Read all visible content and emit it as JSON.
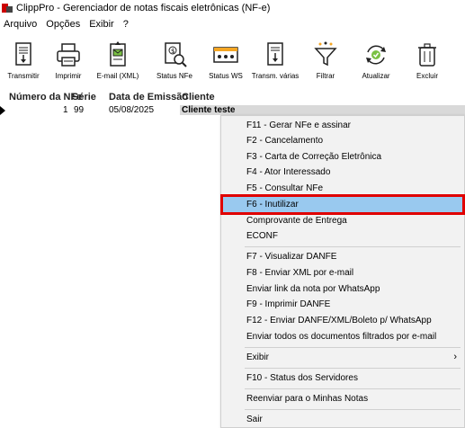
{
  "window": {
    "title": "ClippPro - Gerenciador de notas fiscais eletrônicas (NF-e)"
  },
  "menubar": [
    "Arquivo",
    "Opções",
    "Exibir",
    "?"
  ],
  "toolbar": [
    {
      "label": "Transmitir",
      "icon": "transmit-icon"
    },
    {
      "label": "Imprimir",
      "icon": "printer-icon"
    },
    {
      "label": "E-mail (XML)",
      "icon": "email-xml-icon"
    },
    {
      "label": "Status NFe",
      "icon": "status-nfe-icon"
    },
    {
      "label": "Status WS",
      "icon": "status-ws-icon"
    },
    {
      "label": "Transm. várias",
      "icon": "transmit-multiple-icon"
    },
    {
      "label": "Filtrar",
      "icon": "filter-icon"
    },
    {
      "label": "Atualizar",
      "icon": "refresh-icon"
    },
    {
      "label": "Excluir",
      "icon": "trash-icon"
    }
  ],
  "list": {
    "columns": [
      "Número da NFe",
      "Série",
      "Data de Emissão",
      "Cliente"
    ],
    "rows": [
      {
        "numero": "1",
        "serie": "99",
        "data": "05/08/2025",
        "cliente": "Cliente teste"
      }
    ]
  },
  "context_menu": {
    "items": [
      "F11 - Gerar NFe e assinar",
      "F2 - Cancelamento",
      "F3 - Carta de Correção Eletrônica",
      "F4 - Ator Interessado",
      "F5 - Consultar NFe",
      "F6 - Inutilizar",
      "Comprovante de Entrega",
      "ECONF",
      "F7 - Visualizar DANFE",
      "F8 - Enviar XML por e-mail",
      "Enviar link da nota por WhatsApp",
      "F9 - Imprimir DANFE",
      "F12 - Enviar DANFE/XML/Boleto p/ WhatsApp",
      "Enviar todos os documentos filtrados por e-mail",
      "Exibir",
      "F10 - Status dos Servidores",
      "Reenviar para o Minhas Notas",
      "Sair"
    ],
    "highlighted": "F6 - Inutilizar",
    "submenu_arrow": "›",
    "highlight_color": "#99c9ef",
    "annotation_color": "#e00000"
  }
}
